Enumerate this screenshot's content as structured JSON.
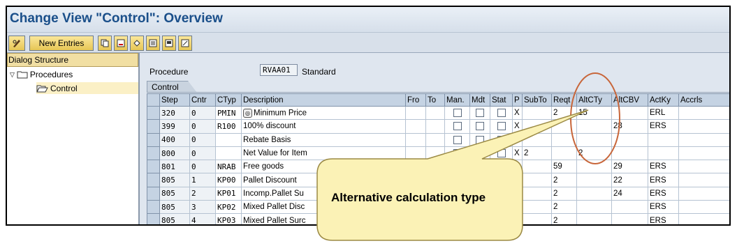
{
  "window": {
    "title": "Change View \"Control\": Overview"
  },
  "toolbar": {
    "new_entries_label": "New Entries"
  },
  "sidebar": {
    "header": "Dialog Structure",
    "items": [
      {
        "label": "Procedures"
      },
      {
        "label": "Control"
      }
    ]
  },
  "procedure": {
    "label": "Procedure",
    "value": "RVAA01",
    "description": "Standard"
  },
  "tab": {
    "label": "Control"
  },
  "table": {
    "columns": [
      "Step",
      "Cntr",
      "CTyp",
      "Description",
      "Fro",
      "To",
      "Man.",
      "Mdt",
      "Stat",
      "P",
      "SubTo",
      "Reqt",
      "AltCTy",
      "AltCBV",
      "ActKy",
      "Accrls"
    ],
    "rows": [
      {
        "step": "320",
        "cntr": "0",
        "ctyp": "PMIN",
        "desc": "Minimum Price",
        "p": "X",
        "subto": "",
        "reqt": "2",
        "altcty": "15",
        "altcbv": "",
        "actky": "ERL"
      },
      {
        "step": "399",
        "cntr": "0",
        "ctyp": "R100",
        "desc": "100% discount",
        "p": "X",
        "subto": "",
        "reqt": "",
        "altcty": "",
        "altcbv": "28",
        "actky": "ERS"
      },
      {
        "step": "400",
        "cntr": "0",
        "ctyp": "",
        "desc": "Rebate Basis",
        "p": "",
        "subto": "",
        "reqt": "",
        "altcty": "",
        "altcbv": "",
        "actky": ""
      },
      {
        "step": "800",
        "cntr": "0",
        "ctyp": "",
        "desc": "Net Value for Item",
        "p": "X",
        "subto": "2",
        "reqt": "",
        "altcty": "2",
        "altcbv": "",
        "actky": ""
      },
      {
        "step": "801",
        "cntr": "0",
        "ctyp": "NRAB",
        "desc": "Free goods",
        "p": "X",
        "subto": "",
        "reqt": "59",
        "altcty": "",
        "altcbv": "29",
        "actky": "ERS"
      },
      {
        "step": "805",
        "cntr": "1",
        "ctyp": "KP00",
        "desc": "Pallet Discount",
        "p": "",
        "subto": "",
        "reqt": "2",
        "altcty": "",
        "altcbv": "22",
        "actky": "ERS"
      },
      {
        "step": "805",
        "cntr": "2",
        "ctyp": "KP01",
        "desc": "Incomp.Pallet Su",
        "p": "",
        "subto": "",
        "reqt": "2",
        "altcty": "",
        "altcbv": "24",
        "actky": "ERS"
      },
      {
        "step": "805",
        "cntr": "3",
        "ctyp": "KP02",
        "desc": "Mixed Pallet Disc",
        "p": "",
        "subto": "",
        "reqt": "2",
        "altcty": "",
        "altcbv": "",
        "actky": "ERS"
      },
      {
        "step": "805",
        "cntr": "4",
        "ctyp": "KP03",
        "desc": "Mixed Pallet Surc",
        "p": "",
        "subto": "",
        "reqt": "2",
        "altcty": "",
        "altcbv": "",
        "actky": "ERS"
      }
    ]
  },
  "callout": {
    "text": "Alternative calculation type"
  }
}
